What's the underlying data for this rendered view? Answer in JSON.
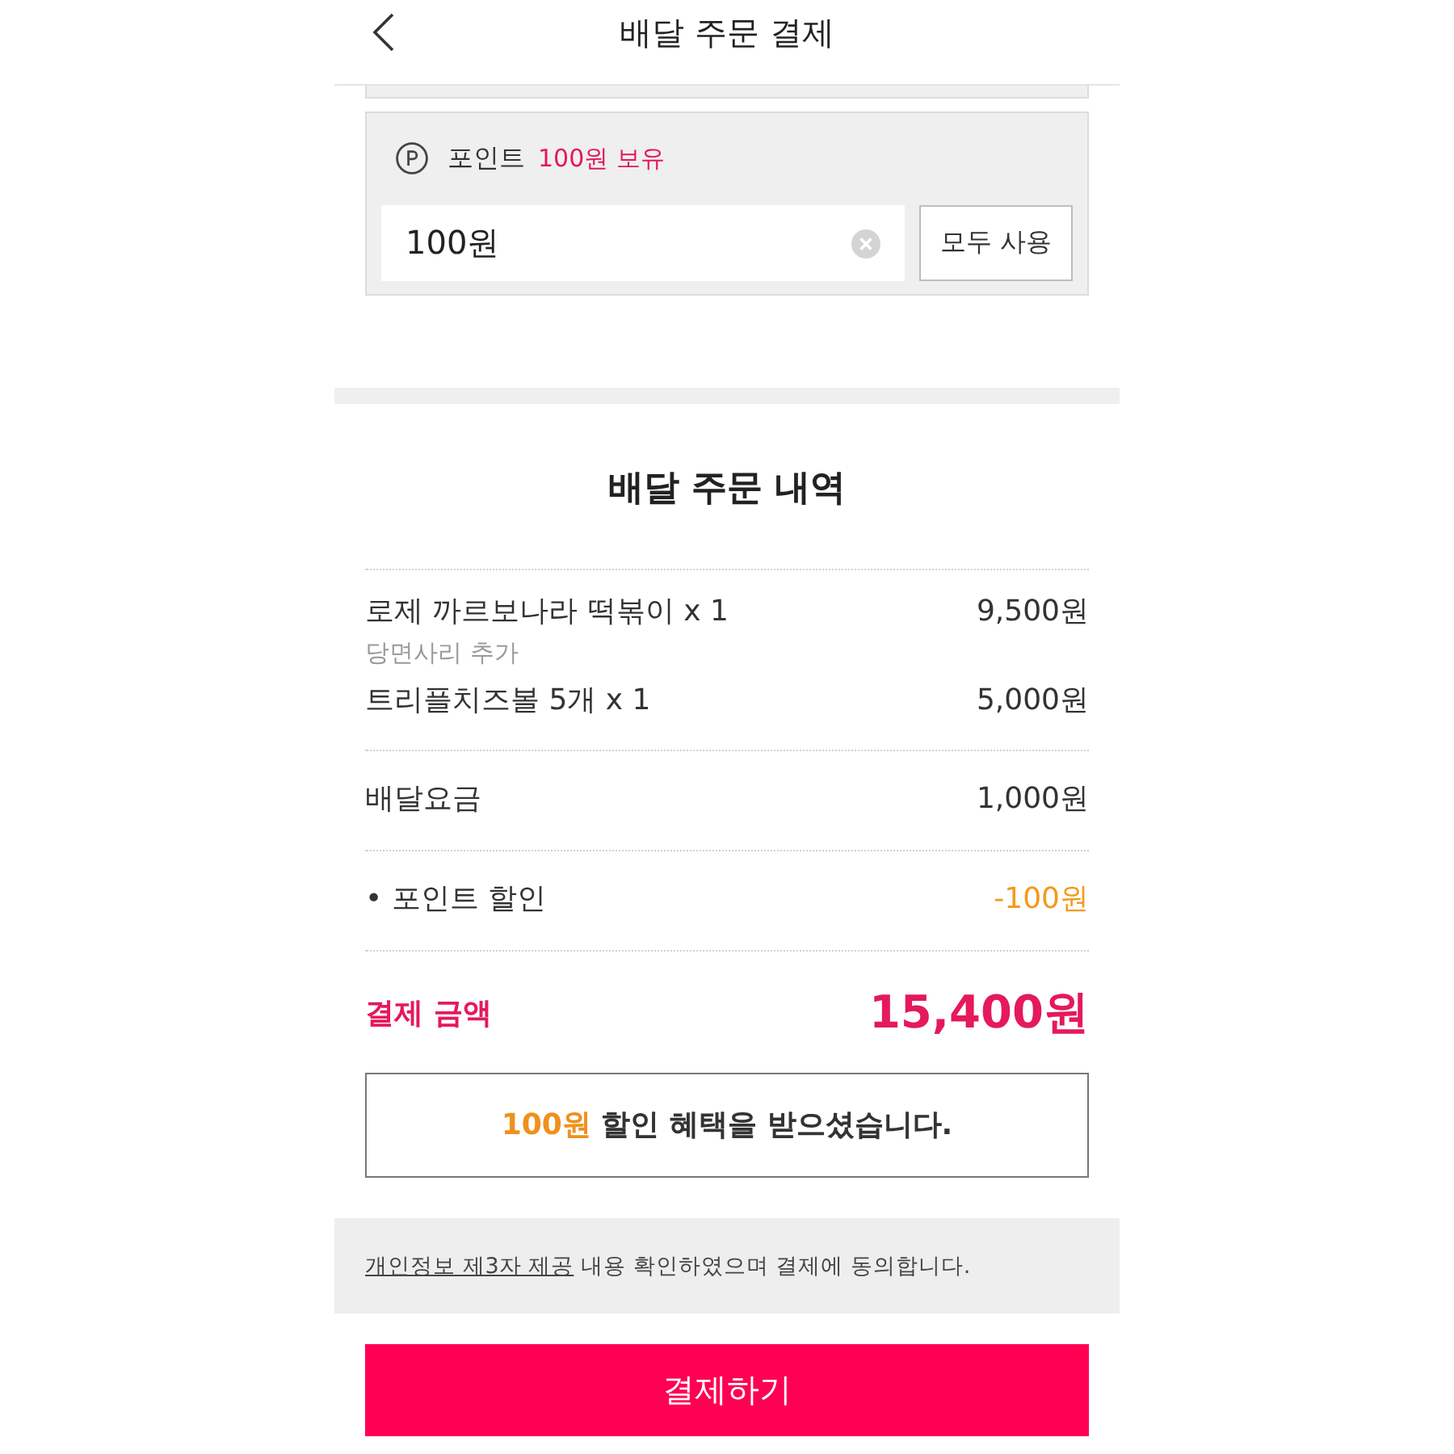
{
  "header": {
    "title": "배달 주문 결제"
  },
  "points": {
    "label": "포인트",
    "balance": "100원 보유",
    "amount_field": {
      "value": "100원"
    },
    "use_all_button": "모두 사용"
  },
  "order_summary": {
    "title": "배달 주문 내역",
    "groups": [
      {
        "lines": [
          {
            "kind": "item",
            "name": "로제 까르보나라 떡볶이 x 1",
            "option": "당면사리 추가",
            "price": "9,500원"
          },
          {
            "kind": "item",
            "name": "트리플치즈볼 5개 x 1",
            "price": "5,000원"
          }
        ]
      },
      {
        "lines": [
          {
            "kind": "fee",
            "name": "배달요금",
            "price": "1,000원"
          }
        ]
      },
      {
        "lines": [
          {
            "kind": "discount",
            "name": "• 포인트 할인",
            "price": "-100원"
          }
        ]
      }
    ],
    "total": {
      "label": "결제 금액",
      "amount": "15,400원"
    },
    "notice": {
      "highlight": "100원",
      "text": "할인 혜택을 받으셨습니다."
    }
  },
  "consent": {
    "link": "개인정보 제3자 제공",
    "text": "내용 확인하였으며 결제에 동의합니다."
  },
  "pay_button": "결제하기"
}
